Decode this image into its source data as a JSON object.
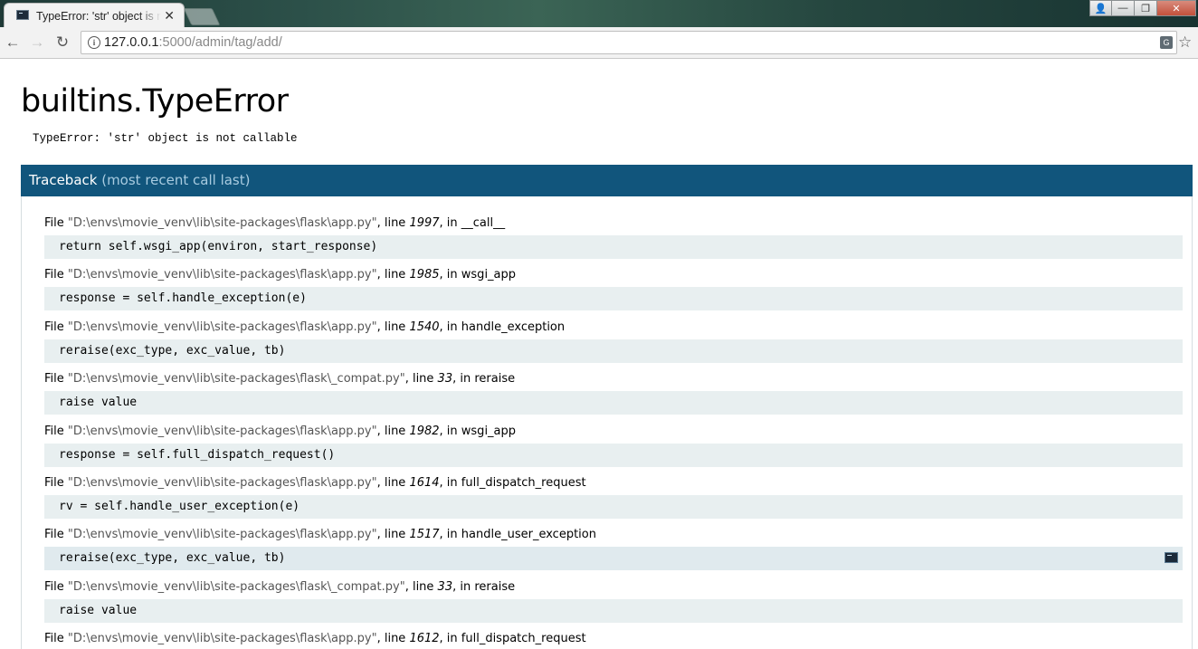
{
  "browser": {
    "tab_title": "TypeError: 'str' object is not callable",
    "tab_close": "✕",
    "url_host": "127.0.0.1",
    "url_rest": ":5000/admin/tag/add/",
    "nav_back": "←",
    "nav_forward": "→",
    "nav_reload": "↻",
    "info": "i",
    "star": "☆",
    "translate": "G",
    "window_controls": {
      "user": "👤",
      "minimize": "—",
      "maximize": "❐",
      "close": "✕"
    }
  },
  "error": {
    "title": "builtins.TypeError",
    "message": "TypeError: 'str' object is not callable"
  },
  "traceback": {
    "label": "Traceback",
    "sublabel": " (most recent call last)",
    "frames": [
      {
        "file": "\"D:\\envs\\movie_venv\\lib\\site-packages\\flask\\app.py\"",
        "line": "1997",
        "func": "__call__",
        "code": "return self.wsgi_app(environ, start_response)"
      },
      {
        "file": "\"D:\\envs\\movie_venv\\lib\\site-packages\\flask\\app.py\"",
        "line": "1985",
        "func": "wsgi_app",
        "code": "response = self.handle_exception(e)"
      },
      {
        "file": "\"D:\\envs\\movie_venv\\lib\\site-packages\\flask\\app.py\"",
        "line": "1540",
        "func": "handle_exception",
        "code": "reraise(exc_type, exc_value, tb)"
      },
      {
        "file": "\"D:\\envs\\movie_venv\\lib\\site-packages\\flask\\_compat.py\"",
        "line": "33",
        "func": "reraise",
        "code": "raise value"
      },
      {
        "file": "\"D:\\envs\\movie_venv\\lib\\site-packages\\flask\\app.py\"",
        "line": "1982",
        "func": "wsgi_app",
        "code": "response = self.full_dispatch_request()"
      },
      {
        "file": "\"D:\\envs\\movie_venv\\lib\\site-packages\\flask\\app.py\"",
        "line": "1614",
        "func": "full_dispatch_request",
        "code": "rv = self.handle_user_exception(e)"
      },
      {
        "file": "\"D:\\envs\\movie_venv\\lib\\site-packages\\flask\\app.py\"",
        "line": "1517",
        "func": "handle_user_exception",
        "code": "reraise(exc_type, exc_value, tb)"
      },
      {
        "file": "\"D:\\envs\\movie_venv\\lib\\site-packages\\flask\\_compat.py\"",
        "line": "33",
        "func": "reraise",
        "code": "raise value"
      },
      {
        "file": "\"D:\\envs\\movie_venv\\lib\\site-packages\\flask\\app.py\"",
        "line": "1612",
        "func": "full_dispatch_request",
        "code": ""
      }
    ],
    "labels": {
      "file_prefix": "File ",
      "line_prefix": ", line ",
      "in_prefix": ", in "
    }
  },
  "colors": {
    "header_bg": "#11557c",
    "code_bg": "#e8eff0"
  }
}
